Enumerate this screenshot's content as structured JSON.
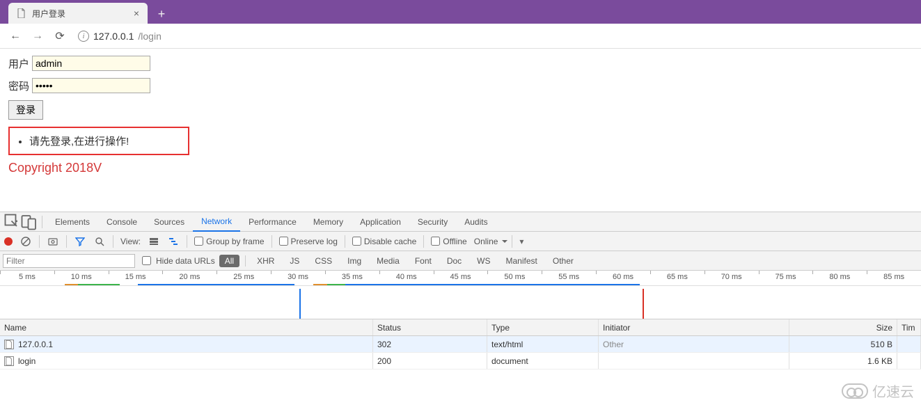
{
  "browser": {
    "tab_title": "用户登录",
    "url_host": "127.0.0.1",
    "url_path": "/login"
  },
  "login_form": {
    "user_label": "用户",
    "user_value": "admin",
    "pass_label": "密码",
    "pass_value": "•••••",
    "submit_label": "登录",
    "message": "请先登录,在进行操作!",
    "copyright": "Copyright 2018V"
  },
  "devtools": {
    "panels": [
      "Elements",
      "Console",
      "Sources",
      "Network",
      "Performance",
      "Memory",
      "Application",
      "Security",
      "Audits"
    ],
    "active_panel": "Network",
    "toolbar": {
      "view_label": "View:",
      "group_label": "Group by frame",
      "preserve_label": "Preserve log",
      "disable_cache_label": "Disable cache",
      "offline_label": "Offline",
      "online_label": "Online"
    },
    "filters": {
      "placeholder": "Filter",
      "hide_label": "Hide data URLs",
      "types": [
        "All",
        "XHR",
        "JS",
        "CSS",
        "Img",
        "Media",
        "Font",
        "Doc",
        "WS",
        "Manifest",
        "Other"
      ],
      "active_type": "All"
    },
    "timeline_ticks": [
      "5 ms",
      "10 ms",
      "15 ms",
      "20 ms",
      "25 ms",
      "30 ms",
      "35 ms",
      "40 ms",
      "45 ms",
      "50 ms",
      "55 ms",
      "60 ms",
      "65 ms",
      "70 ms",
      "75 ms",
      "80 ms",
      "85 ms"
    ],
    "columns": {
      "name": "Name",
      "status": "Status",
      "type": "Type",
      "initiator": "Initiator",
      "size": "Size",
      "time": "Tim"
    },
    "rows": [
      {
        "name": "127.0.0.1",
        "status": "302",
        "type": "text/html",
        "initiator": "Other",
        "size": "510 B",
        "selected": true
      },
      {
        "name": "login",
        "status": "200",
        "type": "document",
        "initiator": "",
        "size": "1.6 KB",
        "selected": false
      }
    ]
  },
  "watermark": "亿速云"
}
